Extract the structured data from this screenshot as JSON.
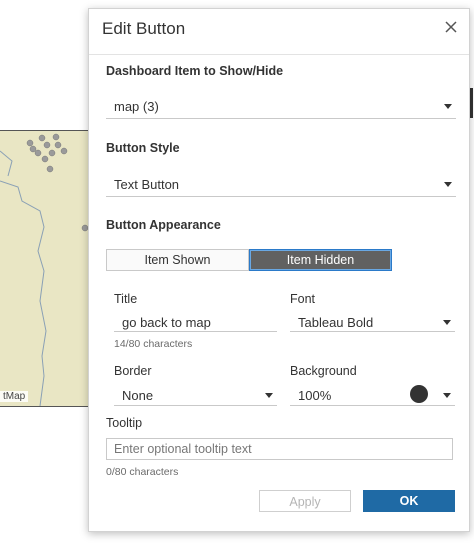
{
  "background": {
    "map_credit": "tMap"
  },
  "dialog": {
    "title": "Edit Button",
    "show_hide_label": "Dashboard Item to Show/Hide",
    "show_hide_value": "map (3)",
    "button_style_label": "Button Style",
    "button_style_value": "Text Button",
    "appearance_label": "Button Appearance",
    "appearance_tabs": [
      "Item Shown",
      "Item Hidden"
    ],
    "active_tab": "Item Hidden",
    "title_label": "Title",
    "title_value": "go back to map",
    "title_count": "14/80 characters",
    "font_label": "Font",
    "font_value": "Tableau Bold",
    "border_label": "Border",
    "border_value": "None",
    "background_label": "Background",
    "background_value": "100%",
    "background_color": "#333333",
    "tooltip_label": "Tooltip",
    "tooltip_placeholder": "Enter optional tooltip text",
    "tooltip_count": "0/80 characters",
    "apply_label": "Apply",
    "ok_label": "OK",
    "accent_color": "#1f6aa5"
  }
}
